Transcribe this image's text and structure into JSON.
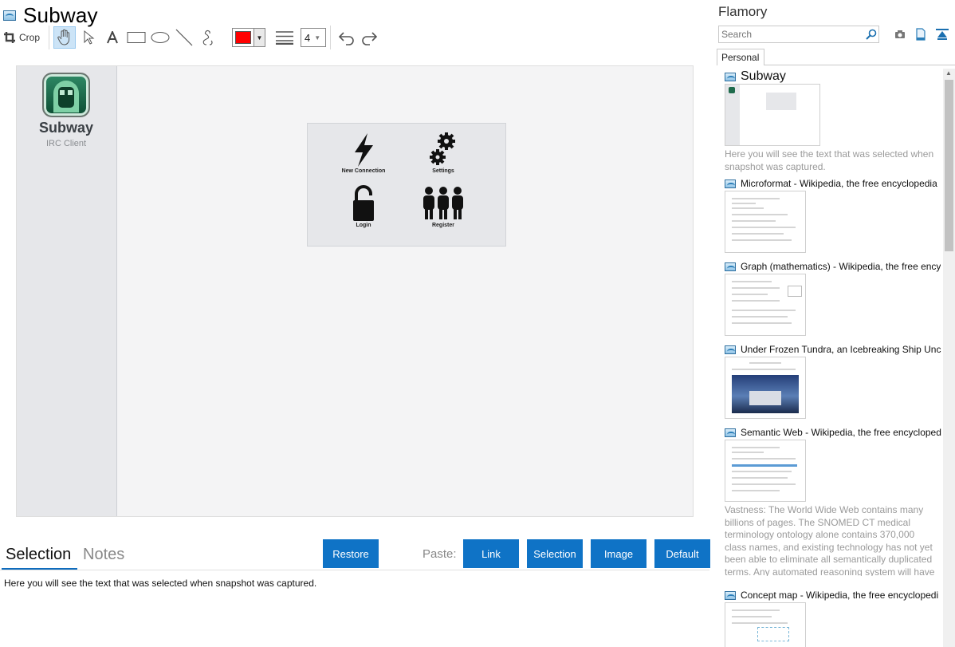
{
  "window": {
    "title": "Subway"
  },
  "toolbar": {
    "crop_label": "Crop",
    "color": "#ff0000",
    "line_width": "4"
  },
  "snapshot": {
    "app_name": "Subway",
    "app_desc": "IRC Client",
    "menu": [
      {
        "label": "New Connection",
        "icon": "lightning-bolt-icon"
      },
      {
        "label": "Settings",
        "icon": "gears-icon"
      },
      {
        "label": "Login",
        "icon": "padlock-icon"
      },
      {
        "label": "Register",
        "icon": "people-icon"
      }
    ]
  },
  "bottom": {
    "tab_selection": "Selection",
    "tab_notes": "Notes",
    "restore": "Restore",
    "paste_label": "Paste:",
    "paste_link": "Link",
    "paste_selection": "Selection",
    "paste_image": "Image",
    "paste_default": "Default",
    "selection_text": "Here you will see the text that was selected when snapshot was captured."
  },
  "side": {
    "title": "Flamory",
    "search_placeholder": "Search",
    "tab_personal": "Personal",
    "entries": [
      {
        "title": "Subway",
        "note": "Here you will see the text that was selected when snapshot was captured."
      },
      {
        "title": "Microformat - Wikipedia, the free encyclopedia",
        "note": ""
      },
      {
        "title": "Graph (mathematics) - Wikipedia, the free ency",
        "note": ""
      },
      {
        "title": "Under Frozen Tundra, an Icebreaking Ship Unco",
        "note": ""
      },
      {
        "title": "Semantic Web - Wikipedia, the free encycloped",
        "note": "Vastness: The World Wide Web contains many billions of pages. The SNOMED CT medical terminology ontology alone contains 370,000 class names, and existing technology has not yet been able to eliminate all semantically duplicated terms. Any automated reasoning system will have to deal with truly huge inputs."
      },
      {
        "title": "Concept map - Wikipedia, the free encyclopedi",
        "note": ""
      }
    ]
  },
  "colors": {
    "accent": "#0f73c6",
    "pen": "#ff0000"
  }
}
